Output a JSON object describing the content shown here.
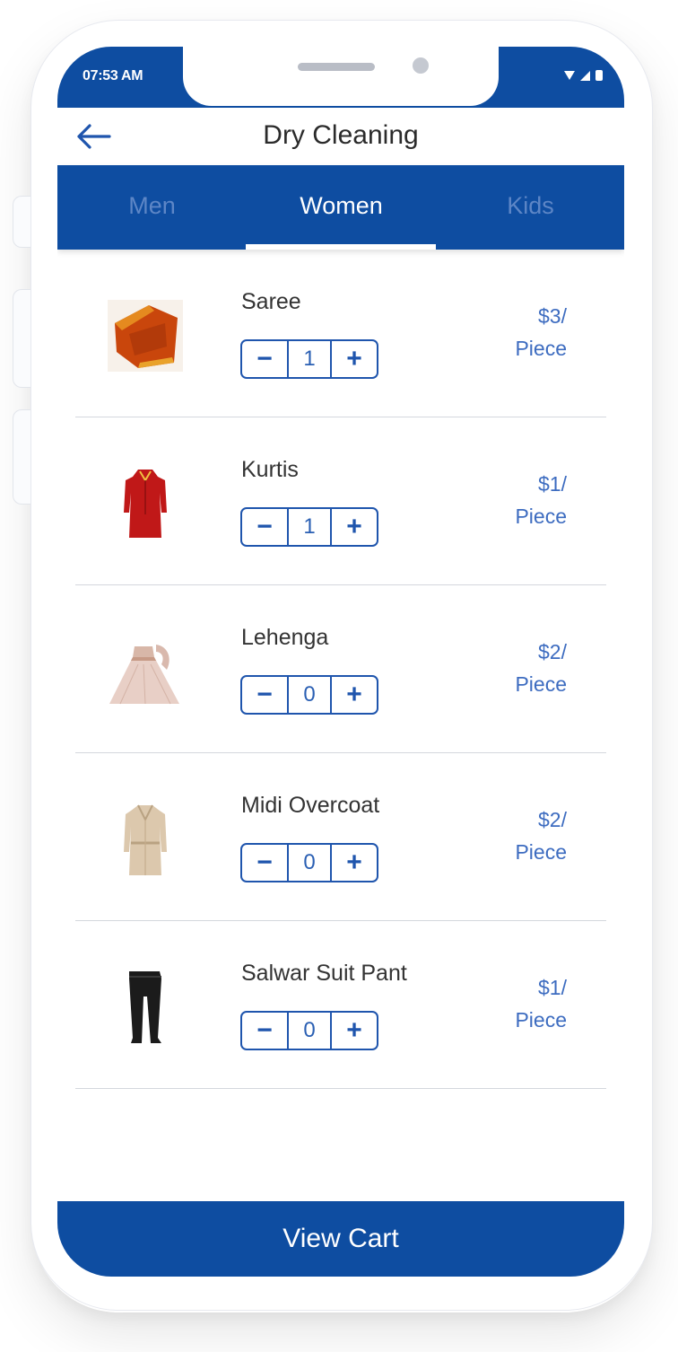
{
  "status": {
    "time": "07:53 AM"
  },
  "header": {
    "title": "Dry Cleaning"
  },
  "tabs": [
    {
      "label": "Men",
      "active": false
    },
    {
      "label": "Women",
      "active": true
    },
    {
      "label": "Kids",
      "active": false
    }
  ],
  "stepper": {
    "minus": "−",
    "plus": "+"
  },
  "items": [
    {
      "name": "Saree",
      "qty": "1",
      "price": "$3/",
      "unit": "Piece",
      "thumb": "saree"
    },
    {
      "name": "Kurtis",
      "qty": "1",
      "price": "$1/",
      "unit": "Piece",
      "thumb": "kurti"
    },
    {
      "name": "Lehenga",
      "qty": "0",
      "price": "$2/",
      "unit": "Piece",
      "thumb": "lehenga"
    },
    {
      "name": "Midi Overcoat",
      "qty": "0",
      "price": "$2/",
      "unit": "Piece",
      "thumb": "overcoat"
    },
    {
      "name": "Salwar Suit Pant",
      "qty": "0",
      "price": "$1/",
      "unit": "Piece",
      "thumb": "pant"
    }
  ],
  "cart": {
    "label": "View Cart"
  },
  "colors": {
    "primary": "#0e4da1",
    "accent": "#1f55ad",
    "price": "#3d6cc0",
    "tab_inactive": "#5d86c6"
  }
}
